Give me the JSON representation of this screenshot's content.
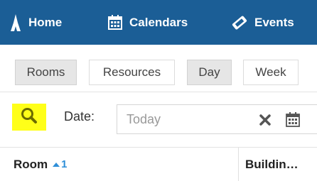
{
  "nav": {
    "home": {
      "label": "Home",
      "icon": "tower-icon"
    },
    "calendars": {
      "label": "Calendars",
      "icon": "calendar-icon"
    },
    "events": {
      "label": "Events",
      "icon": "ticket-icon"
    }
  },
  "tabs": [
    "Rooms",
    "Resources",
    "Day",
    "Week"
  ],
  "active_tabs": [
    "Rooms",
    "Day"
  ],
  "filter": {
    "date_label": "Date:",
    "date_placeholder": "Today",
    "search_icon": "search-icon",
    "clear_icon": "close-icon",
    "calendar_icon": "calendar-icon"
  },
  "table": {
    "columns": [
      {
        "label": "Room",
        "sort_order": "1",
        "sort_direction": "ascending"
      },
      {
        "label": "Buildin…"
      }
    ]
  },
  "colors": {
    "nav_background": "#1b5e96",
    "highlight": "#ffff19",
    "sort_indicator": "#2f8fd8"
  }
}
